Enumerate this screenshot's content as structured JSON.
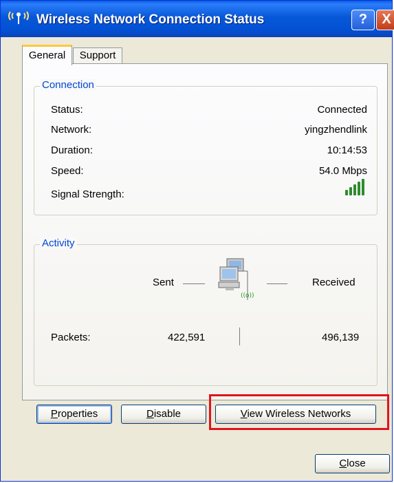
{
  "window": {
    "title": "Wireless Network Connection Status",
    "help_label": "?",
    "close_label": "X"
  },
  "tabs": [
    {
      "label": "General",
      "selected": true
    },
    {
      "label": "Support",
      "selected": false
    }
  ],
  "connection": {
    "legend": "Connection",
    "rows": [
      {
        "label": "Status:",
        "value": "Connected"
      },
      {
        "label": "Network:",
        "value": "yingzhendlink"
      },
      {
        "label": "Duration:",
        "value": "10:14:53"
      },
      {
        "label": "Speed:",
        "value": "54.0 Mbps"
      }
    ],
    "signal_label": "Signal Strength:",
    "signal_bars": 5,
    "signal_color": "#2e8b2e"
  },
  "activity": {
    "legend": "Activity",
    "sent_label": "Sent",
    "received_label": "Received",
    "packets_label": "Packets:",
    "packets_sent": "422,591",
    "packets_received": "496,139",
    "icon": "network-computers-icon"
  },
  "buttons": {
    "properties": {
      "prefix": "",
      "mnemonic": "P",
      "rest": "roperties"
    },
    "disable": {
      "prefix": "",
      "mnemonic": "D",
      "rest": "isable"
    },
    "view_wireless": {
      "prefix": "",
      "mnemonic": "V",
      "rest": "iew Wireless Networks"
    },
    "close": {
      "prefix": "",
      "mnemonic": "C",
      "rest": "lose"
    }
  },
  "colors": {
    "titlebar": "#0758d8",
    "legend": "#0046d5",
    "highlight_border": "#e0141b"
  }
}
